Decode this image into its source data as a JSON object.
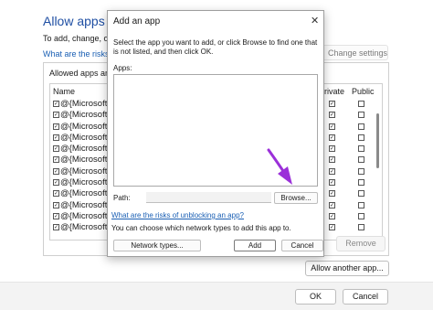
{
  "background": {
    "title": "Allow apps to c",
    "subtitle": "To add, change, or re",
    "risk_link": "What are the risks of",
    "change_settings_label": "Change settings",
    "list_caption": "Allowed apps and",
    "columns": {
      "name": "Name",
      "private": "rivate",
      "public": "Public"
    },
    "rows": [
      {
        "name": "@{Microsoft.Wi"
      },
      {
        "name": "@{Microsoft.Wi"
      },
      {
        "name": "@{Microsoft.Wi"
      },
      {
        "name": "@{Microsoft.Wi"
      },
      {
        "name": "@{Microsoft.Wi"
      },
      {
        "name": "@{Microsoft.Wi"
      },
      {
        "name": "@{Microsoft.Zu"
      },
      {
        "name": "@{Microsoft.Zu"
      },
      {
        "name": "@{Microsoft.Zu"
      },
      {
        "name": "@{MicrosoftWi"
      },
      {
        "name": "@{MicrosoftWi"
      },
      {
        "name": "@{MicrosoftWi"
      }
    ],
    "remove_label": "Remove",
    "allow_another_label": "Allow another app...",
    "ok_label": "OK",
    "cancel_label": "Cancel"
  },
  "dialog": {
    "title": "Add an app",
    "close_glyph": "✕",
    "description": "Select the app you want to add, or click Browse to find one that is not listed, and then click OK.",
    "apps_label": "Apps:",
    "path_label": "Path:",
    "path_value": "",
    "browse_label": "Browse...",
    "risk_link": "What are the risks of unblocking an app?",
    "network_desc": "You can choose which network types to add this app to.",
    "network_types_label": "Network types...",
    "add_label": "Add",
    "cancel_label": "Cancel"
  },
  "colors": {
    "accent": "#1f4fa3",
    "annotation_arrow": "#9b30d9"
  }
}
